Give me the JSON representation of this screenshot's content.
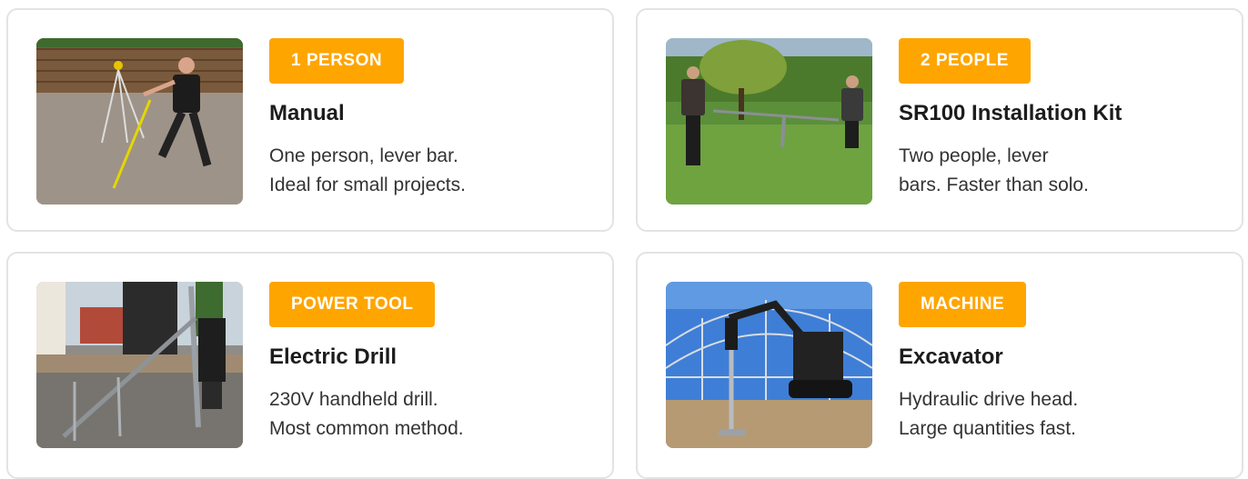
{
  "cards": [
    {
      "badge": "1 PERSON",
      "title": "Manual",
      "desc_line1": "One person, lever bar.",
      "desc_line2": "Ideal for small projects.",
      "image": "man-with-lever-bar-photo"
    },
    {
      "badge": "2 PEOPLE",
      "title": "SR100 Installation Kit",
      "desc_line1": "Two people, lever",
      "desc_line2": "bars. Faster than solo.",
      "image": "two-workers-on-grass-photo"
    },
    {
      "badge": "POWER TOOL",
      "title": "Electric Drill",
      "desc_line1": "230V handheld drill.",
      "desc_line2": "Most common method.",
      "image": "electric-drill-ground-screw-photo"
    },
    {
      "badge": "MACHINE",
      "title": "Excavator",
      "desc_line1": "Hydraulic drive head.",
      "desc_line2": "Large quantities fast.",
      "image": "excavator-under-greenhouse-photo"
    }
  ],
  "colors": {
    "badge_bg": "#ffa500",
    "card_border": "#e3e3e3"
  }
}
